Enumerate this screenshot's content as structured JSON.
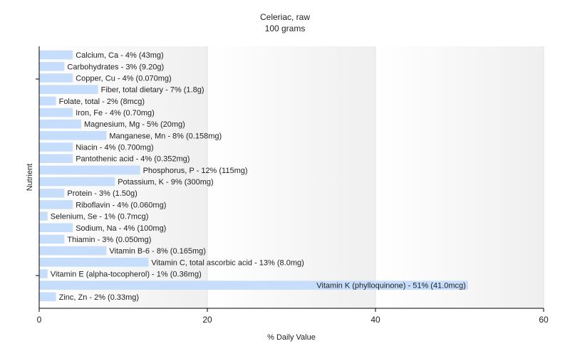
{
  "chart_data": {
    "type": "bar",
    "orientation": "horizontal",
    "title": "Celeriac, raw",
    "subtitle": "100 grams",
    "xlabel": "% Daily Value",
    "ylabel": "Nutrient",
    "xlim": [
      0,
      60
    ],
    "xticks": [
      0,
      20,
      40,
      60
    ],
    "grid": true,
    "colors": {
      "bar": "#c6defb",
      "background_band": "#f4f4f4",
      "axis": "#000000",
      "grid": "#e3e3e3"
    },
    "categories": [
      "Calcium, Ca",
      "Carbohydrates",
      "Copper, Cu",
      "Fiber, total dietary",
      "Folate, total",
      "Iron, Fe",
      "Magnesium, Mg",
      "Manganese, Mn",
      "Niacin",
      "Pantothenic acid",
      "Phosphorus, P",
      "Potassium, K",
      "Protein",
      "Riboflavin",
      "Selenium, Se",
      "Sodium, Na",
      "Thiamin",
      "Vitamin B-6",
      "Vitamin C, total ascorbic acid",
      "Vitamin E (alpha-tocopherol)",
      "Vitamin K (phylloquinone)",
      "Zinc, Zn"
    ],
    "values": [
      4,
      3,
      4,
      7,
      2,
      4,
      5,
      8,
      4,
      4,
      12,
      9,
      3,
      4,
      1,
      4,
      3,
      8,
      13,
      1,
      51,
      2
    ],
    "labels": [
      "Calcium, Ca - 4% (43mg)",
      "Carbohydrates - 3% (9.20g)",
      "Copper, Cu - 4% (0.070mg)",
      "Fiber, total dietary - 7% (1.8g)",
      "Folate, total - 2% (8mcg)",
      "Iron, Fe - 4% (0.70mg)",
      "Magnesium, Mg - 5% (20mg)",
      "Manganese, Mn - 8% (0.158mg)",
      "Niacin - 4% (0.700mg)",
      "Pantothenic acid - 4% (0.352mg)",
      "Phosphorus, P - 12% (115mg)",
      "Potassium, K - 9% (300mg)",
      "Protein - 3% (1.50g)",
      "Riboflavin - 4% (0.060mg)",
      "Selenium, Se - 1% (0.7mcg)",
      "Sodium, Na - 4% (100mg)",
      "Thiamin - 3% (0.050mg)",
      "Vitamin B-6 - 8% (0.165mg)",
      "Vitamin C, total ascorbic acid - 13% (8.0mg)",
      "Vitamin E (alpha-tocopherol) - 1% (0.36mg)",
      "Vitamin K (phylloquinone) - 51% (41.0mcg)",
      "Zinc, Zn - 2% (0.33mg)"
    ]
  }
}
